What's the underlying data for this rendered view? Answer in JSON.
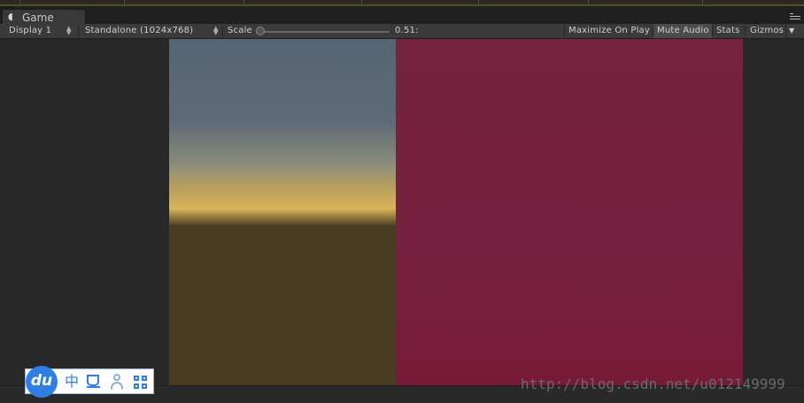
{
  "tab": {
    "icon": "pacman-unity-icon",
    "title": "Game"
  },
  "toolbar": {
    "display": "Display 1",
    "resolution": "Standalone (1024x768)",
    "scale_label": "Scale",
    "scale_value": "0.51:",
    "scale_fraction": 0.02,
    "maximize_on_play": "Maximize On Play",
    "mute_audio": "Mute Audio",
    "mute_audio_active": true,
    "stats": "Stats",
    "gizmos": "Gizmos"
  },
  "scene": {
    "sky_color": "#5e6b76",
    "horizon_color": "#d8b55a",
    "ground_color": "#4a3c21",
    "panel_color": "#76213f"
  },
  "ime": {
    "logo": "du",
    "chinese_mode": "中",
    "icons": [
      "cup-icon",
      "user-icon",
      "grid-icon"
    ],
    "accent": "#2f7fe3"
  },
  "watermark": "http://blog.csdn.net/u012149999"
}
